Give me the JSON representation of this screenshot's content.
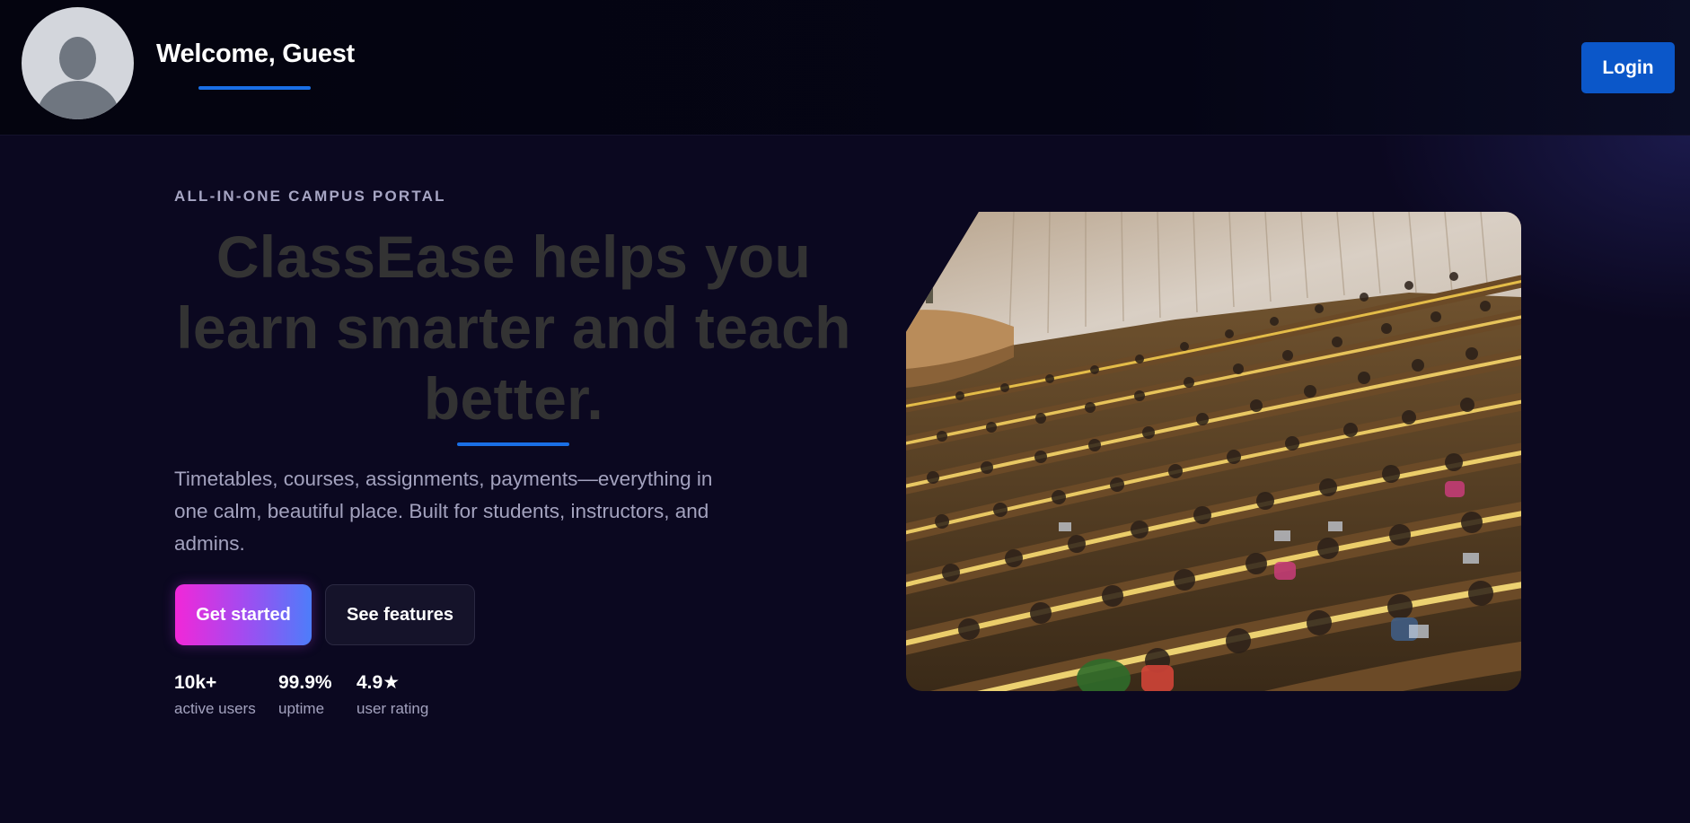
{
  "header": {
    "avatar_icon": "user-avatar-icon",
    "welcome_text": "Welcome, Guest",
    "login_label": "Login",
    "accent_color": "#1a6fe6"
  },
  "hero": {
    "eyebrow": "ALL-IN-ONE CAMPUS PORTAL",
    "headline": "ClassEase helps you learn smarter and teach better.",
    "description": "Timetables, courses, assignments, payments—everything in one calm, beautiful place. Built for students, instructors, and admins.",
    "primary_cta": "Get started",
    "secondary_cta": "See features",
    "stats": [
      {
        "value": "10k+",
        "label": "active users"
      },
      {
        "value": "99.9%",
        "label": "uptime"
      },
      {
        "value": "4.9★",
        "label": "user rating"
      }
    ],
    "image_subject": "lecture-hall-photo"
  },
  "colors": {
    "background": "#0b0820",
    "header_bg": "#05050f",
    "login_button": "#0b57c9",
    "primary_gradient_start": "#f227d8",
    "primary_gradient_end": "#4d7dfa",
    "headline_text": "#333333",
    "muted_text": "#a3a2be"
  }
}
